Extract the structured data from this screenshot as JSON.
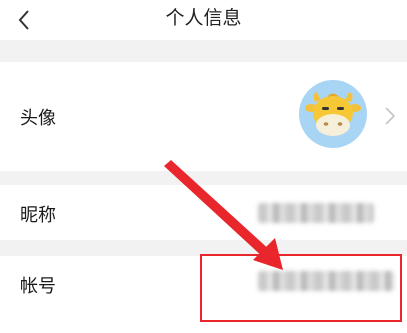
{
  "header": {
    "title": "个人信息",
    "back_icon": "chevron-left-icon"
  },
  "rows": {
    "avatar": {
      "label": "头像",
      "icon": "cow-avatar",
      "chevron_icon": "chevron-right-icon"
    },
    "nickname": {
      "label": "昵称"
    },
    "account": {
      "label": "帐号"
    }
  },
  "annotation": {
    "color": "#e8262b"
  }
}
